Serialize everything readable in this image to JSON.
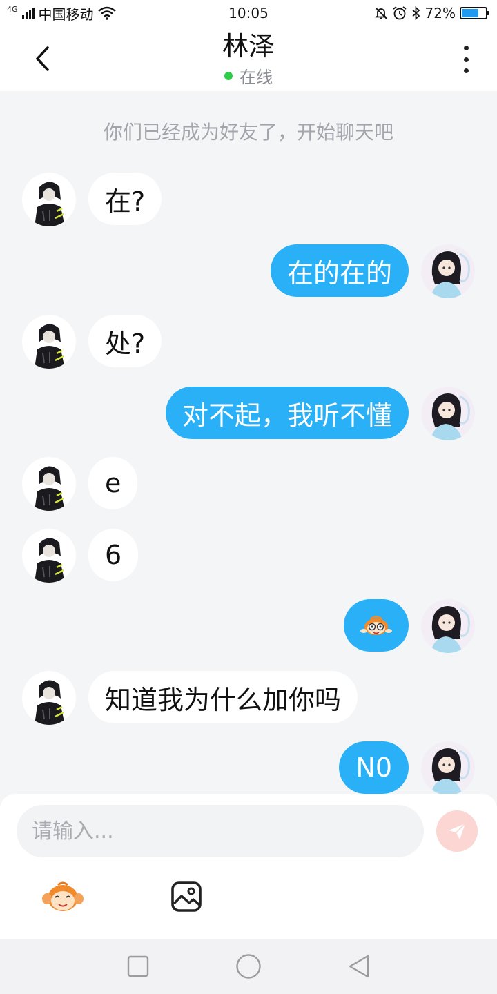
{
  "status_bar": {
    "network": "4G",
    "carrier": "中国移动",
    "time": "10:05",
    "battery_percent": "72%",
    "battery_level": 0.72,
    "icons": [
      "signal-icon",
      "wifi-icon",
      "mute-icon",
      "alarm-icon",
      "bluetooth-icon",
      "battery-icon"
    ]
  },
  "header": {
    "title": "林泽",
    "status": "在线",
    "status_color": "#2ecc4b"
  },
  "chat": {
    "system_message": "你们已经成为好友了，开始聊天吧",
    "messages": [
      {
        "side": "left",
        "text": "在?"
      },
      {
        "side": "right",
        "text": "在的在的"
      },
      {
        "side": "left",
        "text": "处?"
      },
      {
        "side": "right",
        "text": "对不起，我听不懂"
      },
      {
        "side": "left",
        "text": "e"
      },
      {
        "side": "left",
        "text": "6"
      },
      {
        "side": "right",
        "text": "",
        "sticker": "monkey-sticker-icon"
      },
      {
        "side": "left",
        "text": "知道我为什么加你吗"
      },
      {
        "side": "right",
        "text": "N0"
      }
    ],
    "sent_bubble_color": "#2ab0f6",
    "received_bubble_color": "#ffffff"
  },
  "input": {
    "placeholder": "请输入...",
    "send_icon": "paper-plane-icon",
    "send_color": "#fbd6d2"
  },
  "toolbar": {
    "emoji_icon": "monkey-emoji-icon",
    "image_icon": "image-icon"
  },
  "nav": {
    "icons": [
      "recent-apps-icon",
      "home-icon",
      "back-triangle-icon"
    ]
  }
}
